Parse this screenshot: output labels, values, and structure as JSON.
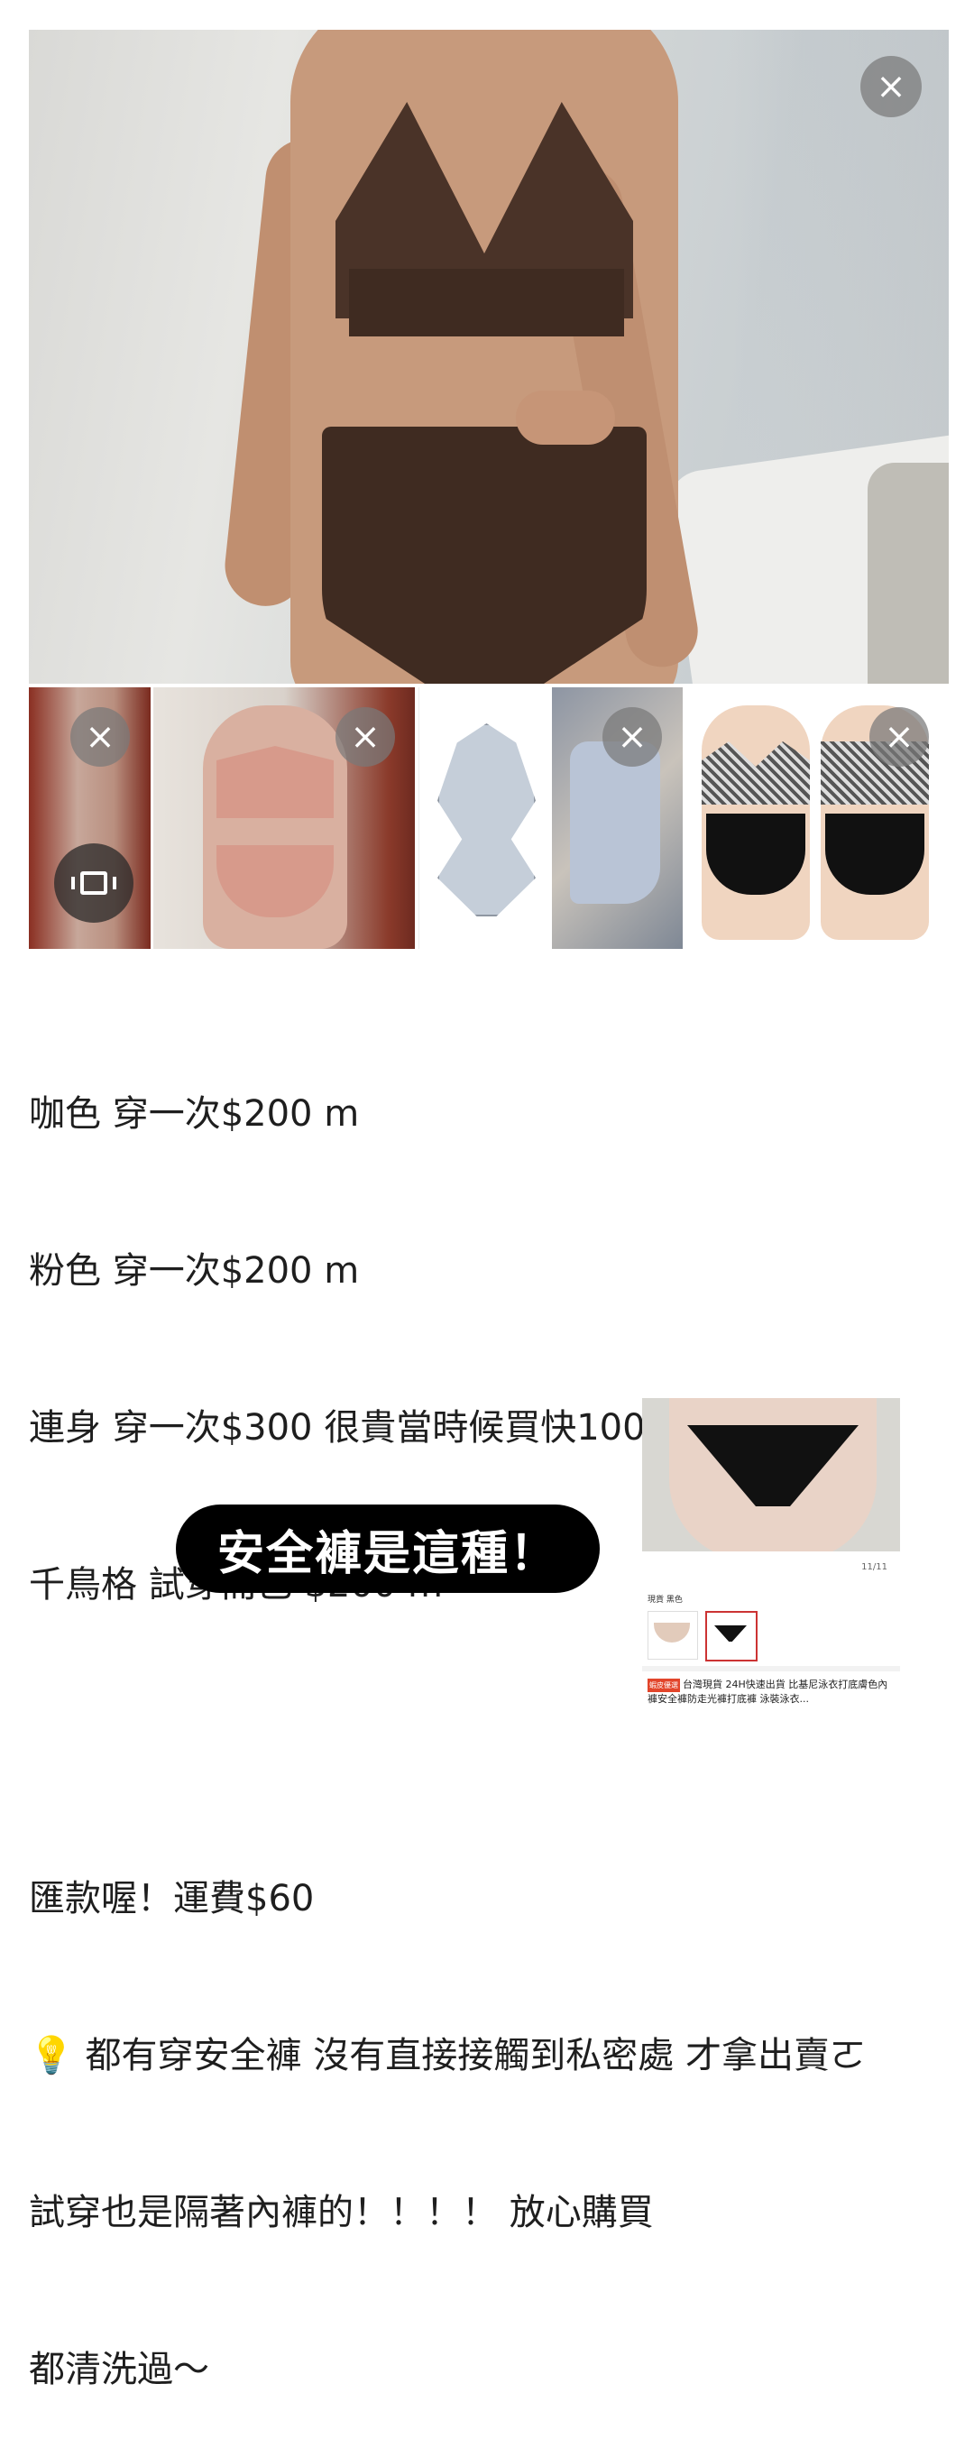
{
  "viewer": {
    "close_icon": "×",
    "thumbnail_close_icon": "×"
  },
  "post": {
    "lines": [
      "咖色 穿一次$200 m",
      "粉色 穿一次$200 m",
      "連身 穿一次$300 很貴當時候買快1000 m",
      "千鳥格 試穿而已 $200 m",
      "",
      "匯款喔！運費$60",
      "💡 都有穿安全褲 沒有直接接觸到私密處 才拿出賣ㄛ",
      "試穿也是隔著內褲的！！！！ 放心購買",
      "都清洗過～"
    ]
  },
  "cta": {
    "label": "安全褲是這種！"
  },
  "product_card": {
    "count": "11/11",
    "variant_label": "現貨 黑色",
    "tag": "蝦皮優選",
    "title": "台灣現貨 24H快速出貨 比基尼泳衣打底膚色內褲安全褲防走光褲打底褲 泳裝泳衣..."
  },
  "colors": {
    "accent_brown": "#3f2b21",
    "cta_bg": "#000000",
    "close_btn_bg": "#7a7a7a"
  }
}
